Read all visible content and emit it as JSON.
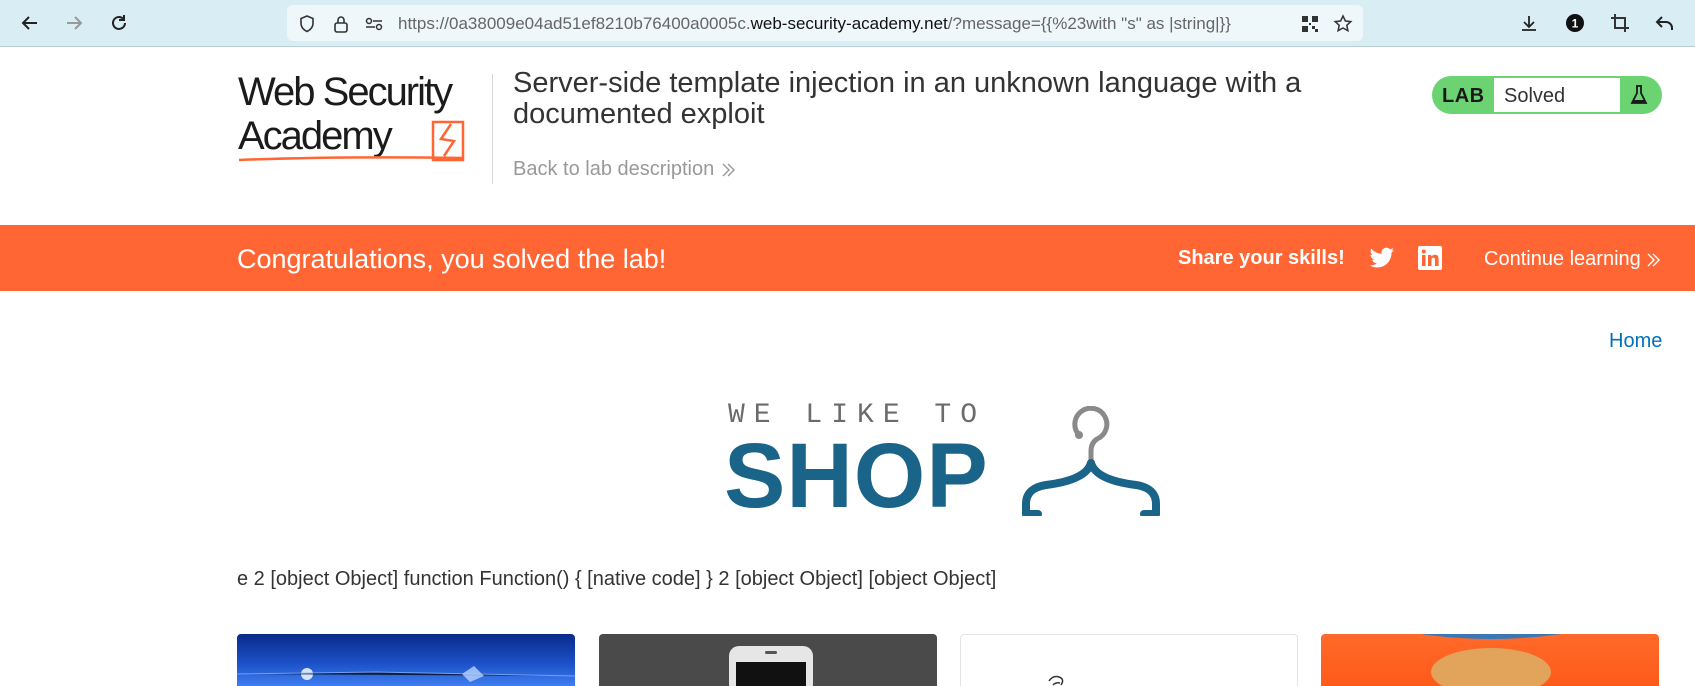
{
  "browser": {
    "url_prefix": "https://0a38009e04ad51ef8210b76400a0005c.",
    "url_host": "web-security-academy.net",
    "url_suffix": "/?message={{%23with \"s\" as |string|}}",
    "notification_badge": "1"
  },
  "header": {
    "logo_line1": "Web Security",
    "logo_line2": "Academy",
    "lab_title": "Server-side template injection in an unknown language with a documented exploit",
    "back_link": "Back to lab description",
    "lab_label": "LAB",
    "lab_status": "Solved",
    "status_color": "#6bd372"
  },
  "banner": {
    "congrats": "Congratulations, you solved the lab!",
    "share": "Share your skills!",
    "continue": "Continue learning",
    "color": "#ff6633"
  },
  "shop": {
    "home_link": "Home",
    "tagline": "WE LIKE TO",
    "brand": "SHOP",
    "message": "e 2 [object Object] function Function() { [native code] } 2 [object Object] [object Object]",
    "brand_color": "#1a6389"
  }
}
